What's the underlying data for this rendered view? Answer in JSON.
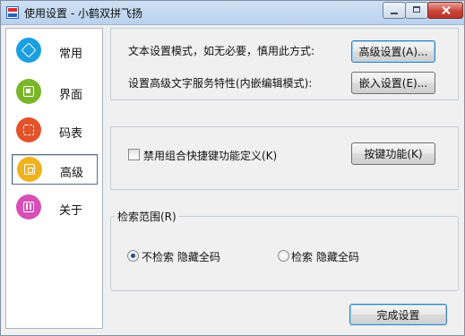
{
  "window": {
    "title": "使用设置 - 小鹤双拼飞扬"
  },
  "sidebar": {
    "items": [
      {
        "label": "常用",
        "icon": "diamond-icon",
        "color": "#1aa0e0",
        "selected": false
      },
      {
        "label": "界面",
        "icon": "layout-icon",
        "color": "#7ab62a",
        "selected": false
      },
      {
        "label": "码表",
        "icon": "code-table-icon",
        "color": "#e2532a",
        "selected": false
      },
      {
        "label": "高级",
        "icon": "advanced-icon",
        "color": "#f0b21c",
        "selected": true
      },
      {
        "label": "关于",
        "icon": "about-icon",
        "color": "#d74fb6",
        "selected": false
      }
    ]
  },
  "text_settings": {
    "mode_label": "文本设置模式，如无必要，慎用此方式:",
    "advanced_button": "高级设置(A)...",
    "service_label": "设置高级文字服务特性(内嵌编辑模式):",
    "embed_button": "嵌入设置(E)..."
  },
  "hotkeys": {
    "checkbox_label": "禁用组合快捷键功能定义(K)",
    "checked": false,
    "hotkey_button": "按键功能(K)"
  },
  "search_range": {
    "title": "检索范围(R)",
    "options": [
      {
        "label": "不检索 隐藏全码",
        "checked": true
      },
      {
        "label": "检索 隐藏全码",
        "checked": false
      }
    ]
  },
  "footer": {
    "finish_button": "完成设置"
  }
}
